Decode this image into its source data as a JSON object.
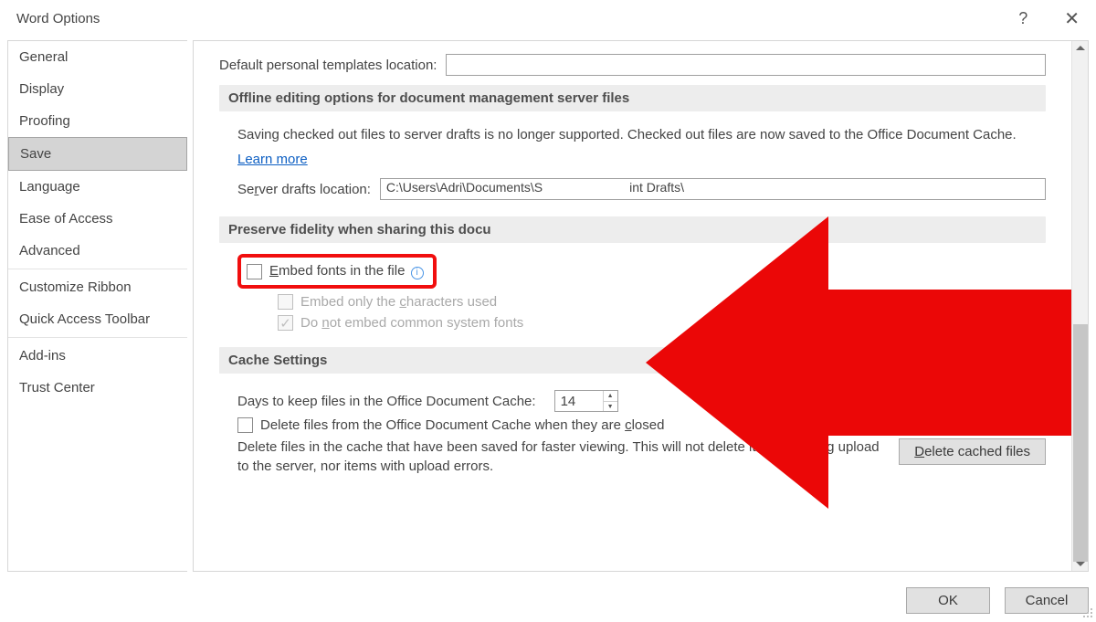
{
  "title": "Word Options",
  "sidebar": {
    "items": [
      {
        "label": "General"
      },
      {
        "label": "Display"
      },
      {
        "label": "Proofing"
      },
      {
        "label": "Save",
        "selected": true
      },
      {
        "label": "Language"
      },
      {
        "label": "Ease of Access"
      },
      {
        "label": "Advanced"
      },
      {
        "label": "Customize Ribbon"
      },
      {
        "label": "Quick Access Toolbar"
      },
      {
        "label": "Add-ins"
      },
      {
        "label": "Trust Center"
      }
    ]
  },
  "templates": {
    "label": "Default personal templates location:",
    "value": ""
  },
  "offline": {
    "header": "Offline editing options for document management server files",
    "note": "Saving checked out files to server drafts is no longer supported. Checked out files are now saved to the Office Document Cache.",
    "learn_more": "Learn more",
    "drafts_label_pre": "Se",
    "drafts_label_accel": "r",
    "drafts_label_post": "ver drafts location:",
    "drafts_value_left": "C:\\Users\\Adri\\Documents\\S",
    "drafts_value_right": "int Drafts\\"
  },
  "fidelity": {
    "header_left": "Preserve fidelity when sharing this docu",
    "embed_pre": "E",
    "embed_post": "mbed fonts in the file",
    "info_icon": "i",
    "sub1_pre": "Embed only the ",
    "sub1_accel": "c",
    "sub1_post": "haracters used",
    "sub2_pre": "Do ",
    "sub2_accel": "n",
    "sub2_post": "ot embed common system fonts",
    "sub2_check": "✓"
  },
  "cache": {
    "header": "Cache Settings",
    "days_label": "Days to keep files in the Office Document Cache:",
    "days_value": "14",
    "delete_closed_pre": "Delete files from the Office Document Cache when they are ",
    "delete_closed_accel": "c",
    "delete_closed_post": "losed",
    "desc": "Delete files in the cache that have been saved for faster viewing. This will not delete items pending upload to the server, nor items with upload errors.",
    "delete_btn_accel": "D",
    "delete_btn_post": "elete cached files"
  },
  "footer": {
    "ok": "OK",
    "cancel": "Cancel"
  }
}
